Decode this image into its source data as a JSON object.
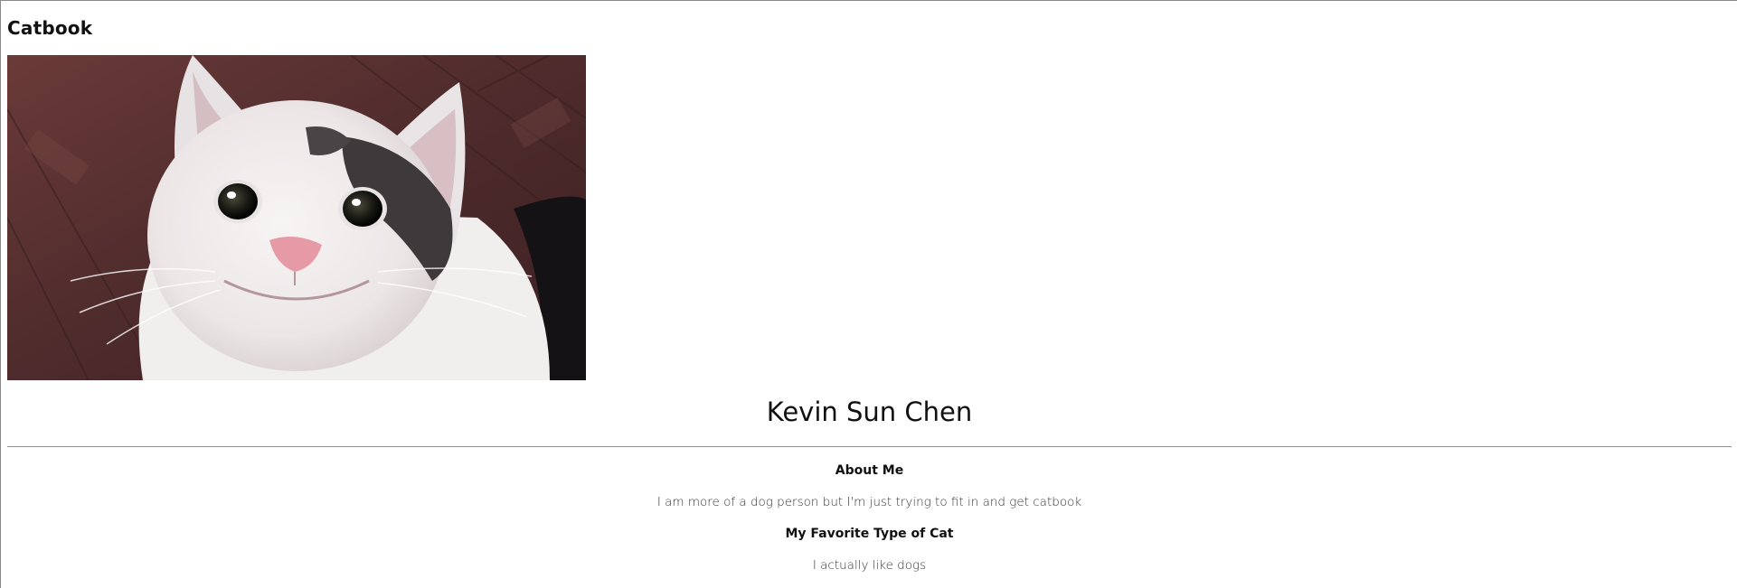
{
  "navbar": {
    "title": "Catbook"
  },
  "profile": {
    "photo_icon": "smiling-cat-photo",
    "name": "Kevin Sun Chen"
  },
  "about": {
    "heading": "About Me",
    "text": "I am more of a dog person but I'm just trying to fit in and get catbook"
  },
  "favorite_cat": {
    "heading": "My Favorite Type of Cat",
    "text": "I actually like dogs"
  }
}
